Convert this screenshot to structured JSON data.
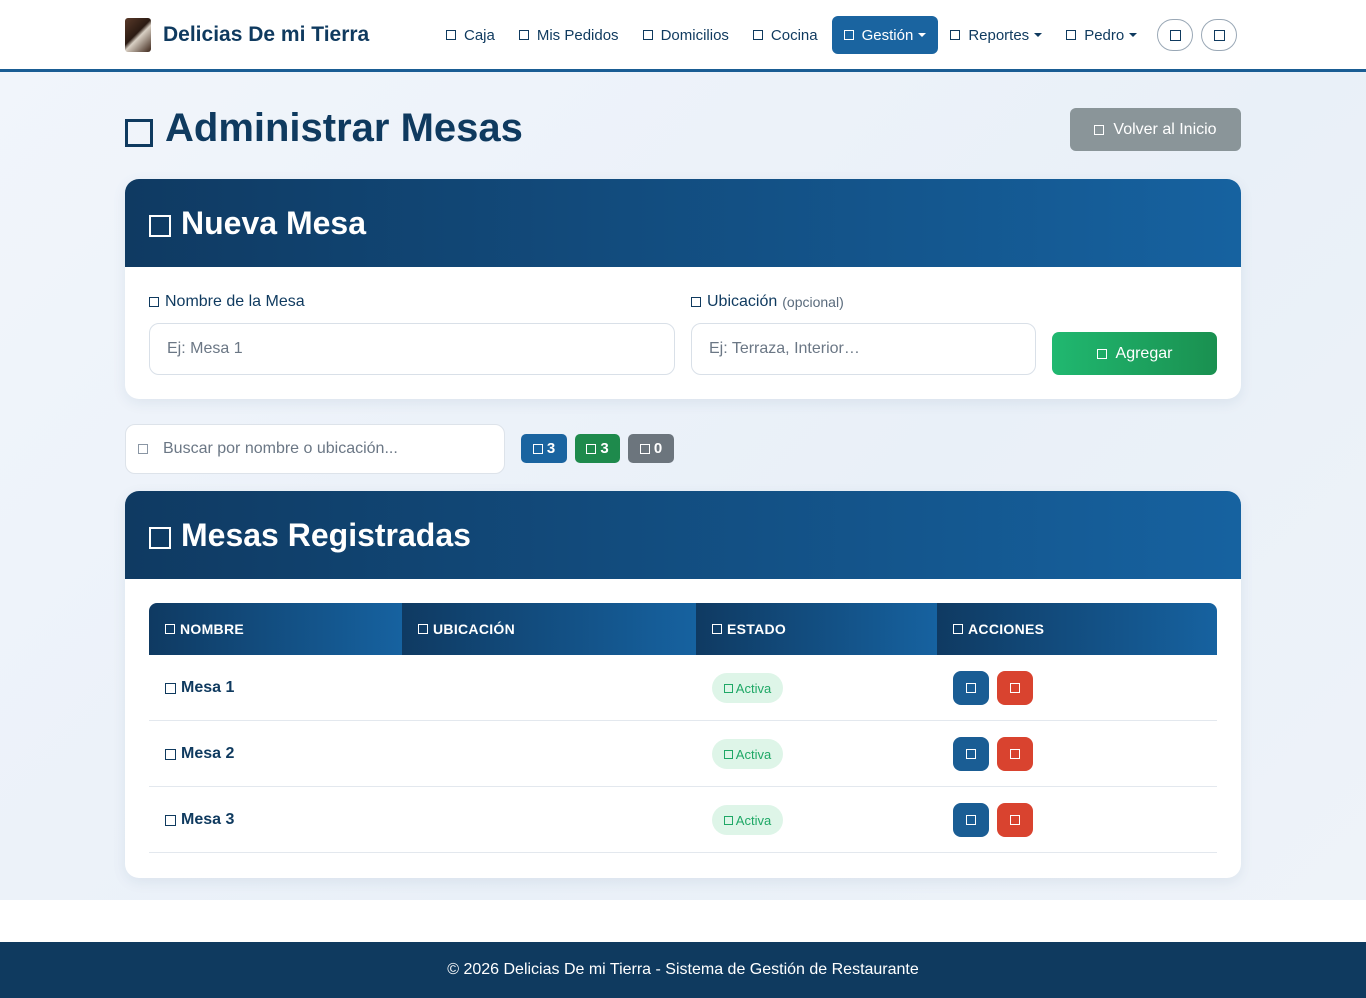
{
  "brand": {
    "name": "Delicias De mi Tierra"
  },
  "nav": {
    "items": [
      {
        "label": "Caja",
        "icon": "cash-register-icon"
      },
      {
        "label": "Mis Pedidos",
        "icon": "receipt-icon"
      },
      {
        "label": "Domicilios",
        "icon": "motorcycle-icon"
      },
      {
        "label": "Cocina",
        "icon": "fire-icon"
      },
      {
        "label": "Gestión",
        "icon": "gears-icon",
        "active": true,
        "dropdown": true
      },
      {
        "label": "Reportes",
        "icon": "chart-icon",
        "dropdown": true
      },
      {
        "label": "Pedro",
        "icon": "user-icon",
        "dropdown": true
      }
    ],
    "extra_buttons": [
      "theme-toggle-icon",
      "logout-icon"
    ]
  },
  "page": {
    "title": "Administrar Mesas",
    "back_button": "Volver al Inicio"
  },
  "new_table": {
    "header": "Nueva Mesa",
    "name_label": "Nombre de la Mesa",
    "name_placeholder": "Ej: Mesa 1",
    "location_label": "Ubicación",
    "location_optional": "(opcional)",
    "location_placeholder": "Ej: Terraza, Interior…",
    "add_button": "Agregar"
  },
  "search": {
    "placeholder": "Buscar por nombre o ubicación..."
  },
  "counts": {
    "total": "3",
    "active": "3",
    "inactive": "0"
  },
  "tables_card": {
    "header": "Mesas Registradas",
    "columns": [
      "NOMBRE",
      "UBICACIÓN",
      "ESTADO",
      "ACCIONES"
    ],
    "rows": [
      {
        "name": "Mesa 1",
        "location": "",
        "status": "Activa"
      },
      {
        "name": "Mesa 2",
        "location": "",
        "status": "Activa"
      },
      {
        "name": "Mesa 3",
        "location": "",
        "status": "Activa"
      }
    ]
  },
  "footer": {
    "text": "© 2026 Delicias De mi Tierra - Sistema de Gestión de Restaurante"
  },
  "colors": {
    "primary": "#1a5d94",
    "dark": "#0f3a5f",
    "success": "#1fa866",
    "danger": "#d9432f",
    "muted": "#8a9599"
  }
}
